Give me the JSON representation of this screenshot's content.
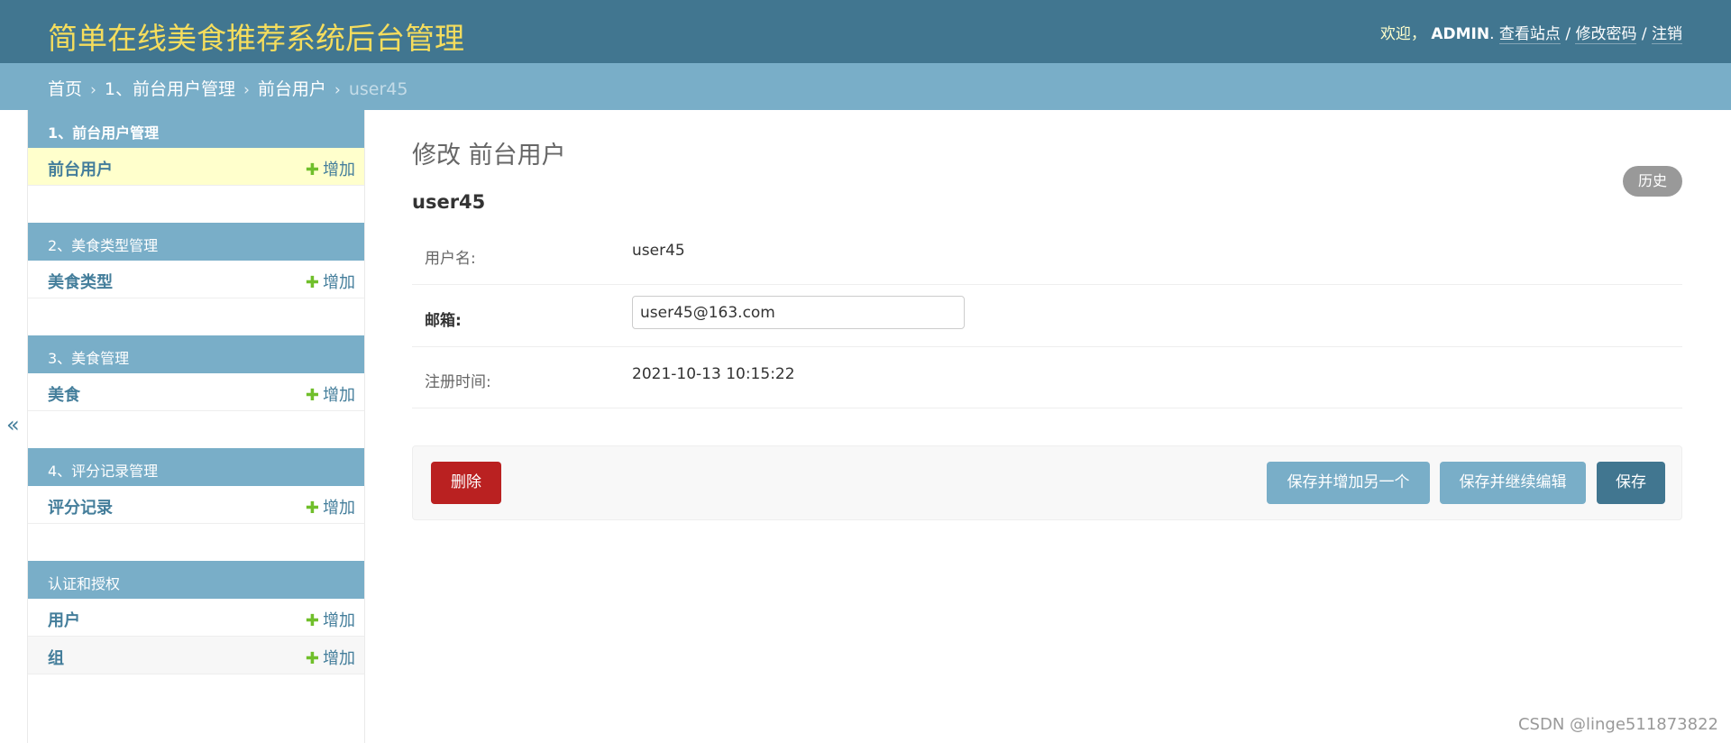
{
  "header": {
    "title": "简单在线美食推荐系统后台管理",
    "welcome": "欢迎，",
    "username": "ADMIN",
    "view_site": "查看站点",
    "change_password": "修改密码",
    "logout": "注销",
    "separator": "/"
  },
  "breadcrumbs": {
    "home": "首页",
    "app": "1、前台用户管理",
    "model": "前台用户",
    "current": "user45",
    "arrow": "›"
  },
  "sidebar": {
    "toggle": "«",
    "add_label": "增加",
    "plus": "✚",
    "modules": [
      {
        "caption": "1、前台用户管理",
        "models": [
          "前台用户"
        ]
      },
      {
        "caption": "2、美食类型管理",
        "models": [
          "美食类型"
        ]
      },
      {
        "caption": "3、美食管理",
        "models": [
          "美食"
        ]
      },
      {
        "caption": "4、评分记录管理",
        "models": [
          "评分记录"
        ]
      },
      {
        "caption": "认证和授权",
        "models": [
          "用户",
          "组"
        ]
      }
    ]
  },
  "content": {
    "title": "修改 前台用户",
    "history": "历史",
    "object_title": "user45",
    "fields": {
      "username_label": "用户名:",
      "username_value": "user45",
      "email_label": "邮箱:",
      "email_value": "user45@163.com",
      "registered_label": "注册时间:",
      "registered_value": "2021-10-13 10:15:22"
    }
  },
  "submit_row": {
    "delete": "删除",
    "save_add_another": "保存并增加另一个",
    "save_continue": "保存并继续编辑",
    "save": "保存"
  },
  "watermark": "CSDN @linge511873822",
  "colors": {
    "header_bg": "#417690",
    "title_color": "#f5dd5d",
    "breadcrumb_bg": "#79aec8",
    "selected_row": "#ffffcc",
    "delete_button": "#ba2121",
    "add_plus": "#70bf2b"
  }
}
